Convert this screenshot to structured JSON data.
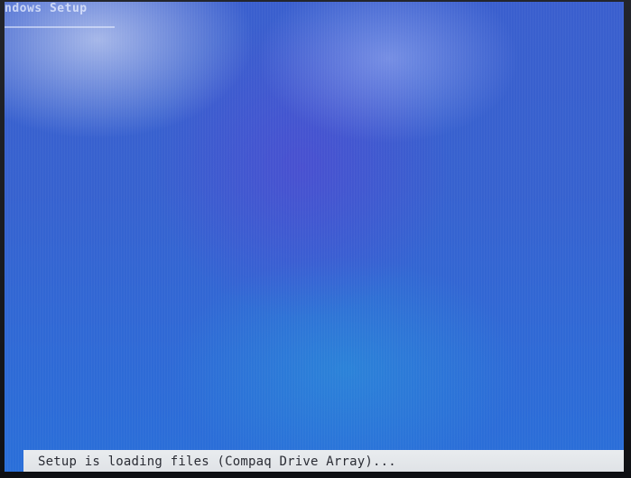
{
  "window": {
    "title": "ndows Setup"
  },
  "status_bar": {
    "text": "Setup is loading files (Compaq Drive Array)..."
  },
  "colors": {
    "screen_background": "#3566d0",
    "status_bar_background": "#e4e7ea",
    "status_text": "#2a2c34"
  }
}
